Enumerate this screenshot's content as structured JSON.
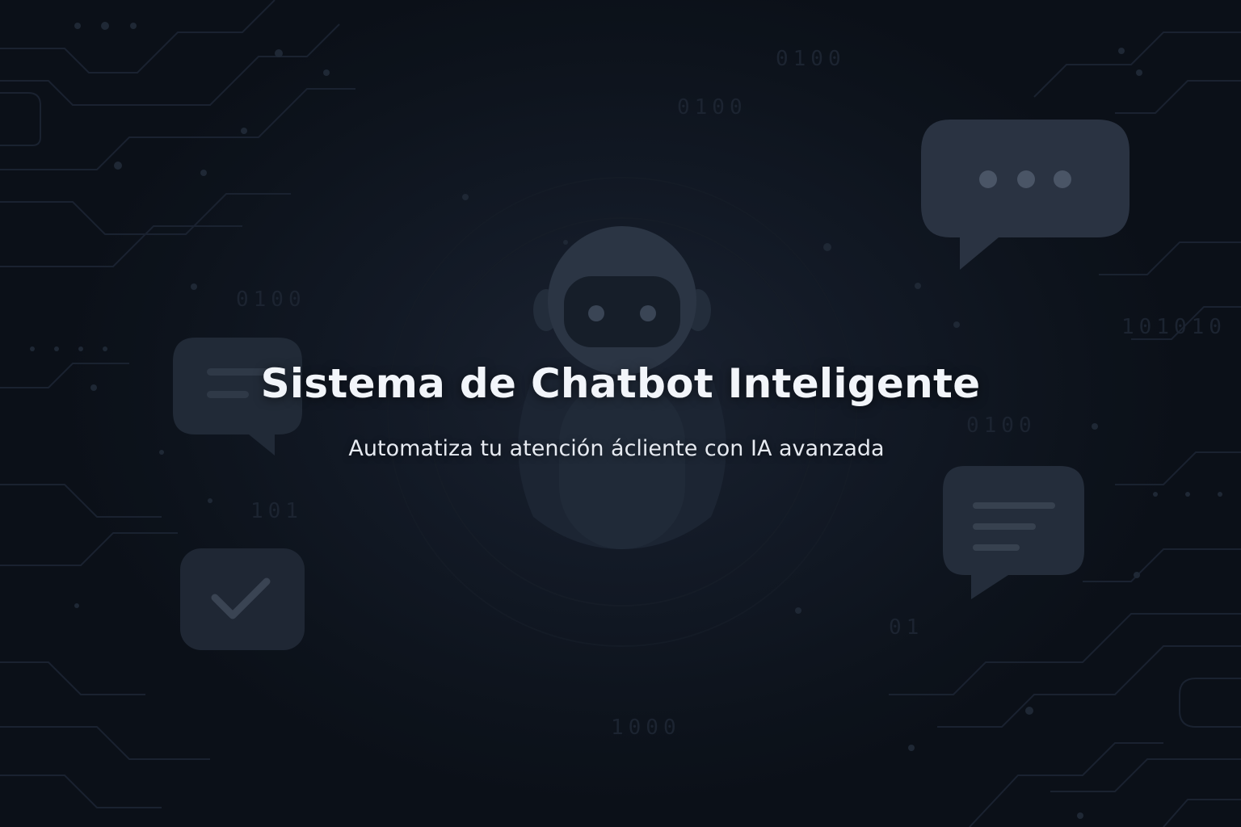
{
  "hero": {
    "title": "Sistema de Chatbot Inteligente",
    "subtitle": "Automatiza tu atención ácliente con IA avanzada"
  },
  "decor": {
    "binary_snippets": [
      "0100",
      "0100",
      "101010",
      "0100",
      "0100",
      "1000",
      "101",
      "01"
    ]
  },
  "icons": {
    "robot": "robot-icon",
    "typing_bubble": "typing-chat-bubble-icon",
    "message_bubble_left": "message-bubble-icon",
    "message_bubble_right": "message-bubble-icon",
    "check": "checkmark-icon"
  },
  "colors": {
    "background": "#0f1520",
    "icon_fill": "#2b3442",
    "title_text": "#f2f5fa",
    "subtitle_text": "#e6eaf1"
  }
}
